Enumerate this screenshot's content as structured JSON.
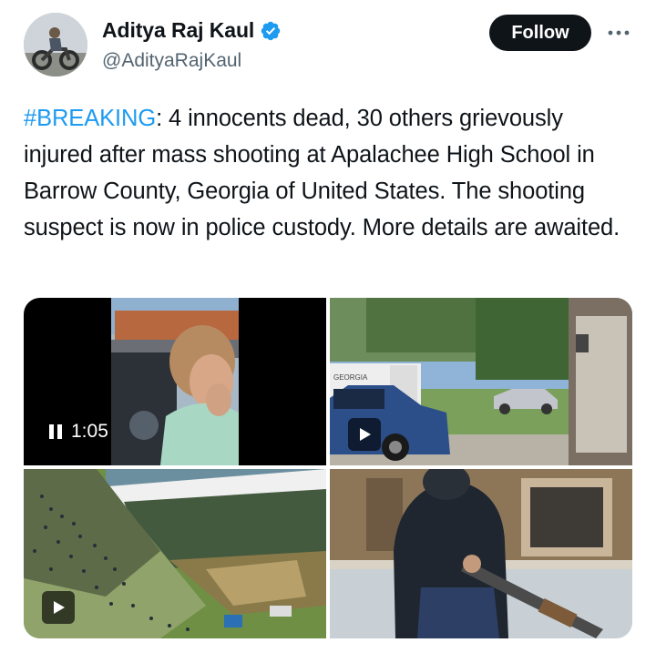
{
  "author": {
    "display_name": "Aditya Raj Kaul",
    "handle": "@AdityaRajKaul",
    "verified_icon": "verified-badge-icon",
    "avatar_icon": "avatar-motorcycle"
  },
  "actions": {
    "follow_label": "Follow",
    "more_icon": "more-icon"
  },
  "tweet": {
    "hashtag": "#BREAKING",
    "body": ": 4 innocents dead, 30 others grievously injured after mass shooting at Apalachee High School in Barrow County, Georgia of United States. The shooting suspect is now in police custody. More details are awaited."
  },
  "media": {
    "video1": {
      "duration": "1:05",
      "state": "pause-icon"
    },
    "video2": {
      "sign_text": "GEORGIA",
      "icon": "play-icon"
    },
    "video3": {
      "icon": "play-icon"
    },
    "video4": {
      "icon": "none"
    }
  },
  "colors": {
    "accent": "#1d9bf0",
    "text": "#0f1419",
    "secondary": "#536471",
    "button": "#0f1419"
  }
}
